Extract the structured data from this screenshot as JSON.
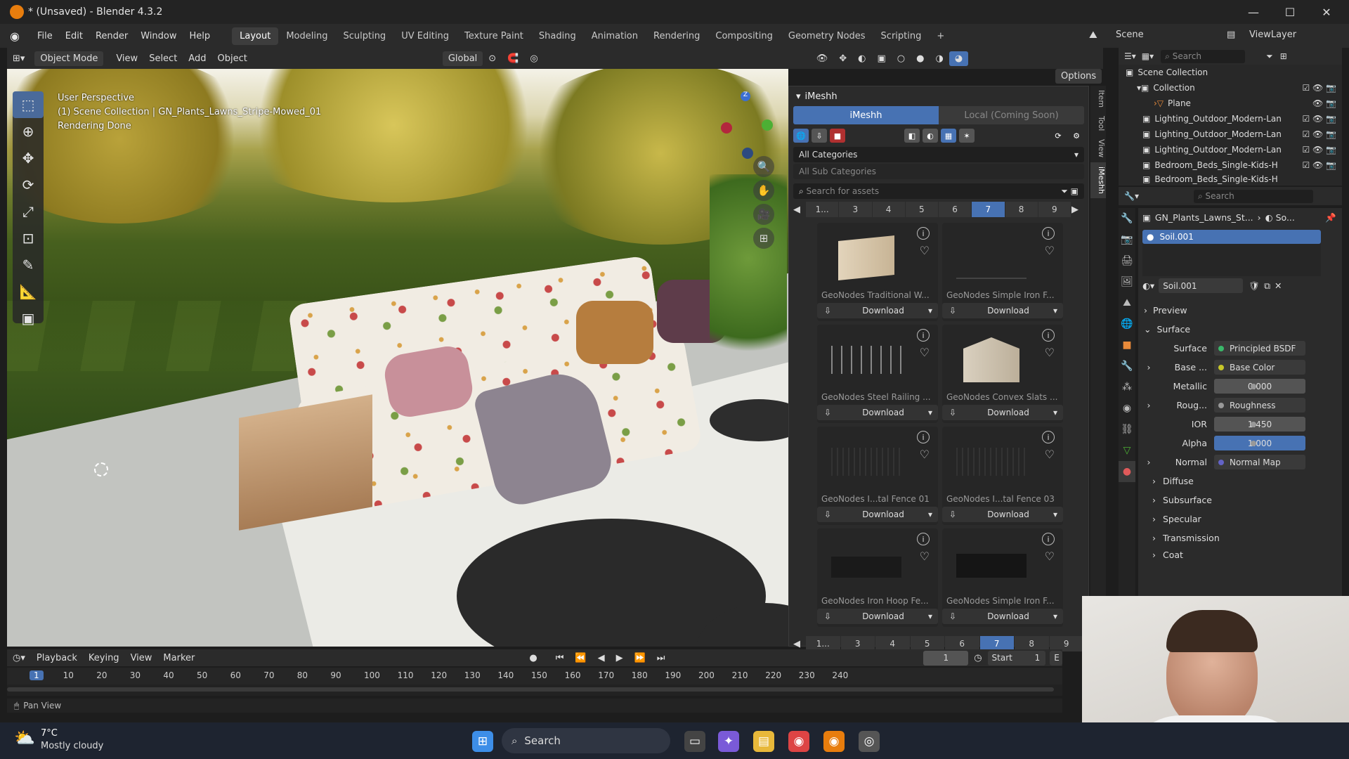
{
  "window": {
    "title": "* (Unsaved) - Blender 4.3.2"
  },
  "menu": [
    "File",
    "Edit",
    "Render",
    "Window",
    "Help"
  ],
  "workspaces": [
    "Layout",
    "Modeling",
    "Sculpting",
    "UV Editing",
    "Texture Paint",
    "Shading",
    "Animation",
    "Rendering",
    "Compositing",
    "Geometry Nodes",
    "Scripting",
    "+"
  ],
  "active_workspace": "Layout",
  "topright": {
    "scene": "Scene",
    "viewlayer": "ViewLayer"
  },
  "viewport_header": {
    "mode": "Object Mode",
    "view": "View",
    "select": "Select",
    "add": "Add",
    "object": "Object",
    "orientation": "Global",
    "options": "Options"
  },
  "overlay": {
    "line1": "User Perspective",
    "line2": "(1) Scene Collection | GN_Plants_Lawns_Stripe-Mowed_01",
    "line3": "Rendering Done"
  },
  "imeshh": {
    "title": "iMeshh",
    "tab_active": "iMeshh",
    "tab_other": "Local (Coming Soon)",
    "category": "All Categories",
    "subcategory": "All Sub Categories",
    "search_placeholder": "Search for assets",
    "pages": [
      "1...",
      "3",
      "4",
      "5",
      "6",
      "7",
      "8",
      "9"
    ],
    "selected_page": "7",
    "download_label": "Download",
    "assets": [
      "GeoNodes Traditional W...",
      "GeoNodes Simple Iron F...",
      "GeoNodes Steel Railing ...",
      "GeoNodes Convex Slats ...",
      "GeoNodes I...tal Fence 01",
      "GeoNodes I...tal Fence 03",
      "GeoNodes Iron Hoop Fe...",
      "GeoNodes Simple Iron F..."
    ]
  },
  "side_tabs": [
    "Item",
    "Tool",
    "View",
    "iMeshh"
  ],
  "outliner": {
    "search_placeholder": "Search",
    "rows": [
      "Scene Collection",
      "Collection",
      "Plane",
      "Lighting_Outdoor_Modern-Lan",
      "Lighting_Outdoor_Modern-Lan",
      "Lighting_Outdoor_Modern-Lan",
      "Bedroom_Beds_Single-Kids-H",
      "Bedroom_Beds_Single-Kids-H"
    ]
  },
  "properties": {
    "search_placeholder": "Search",
    "breadcrumb_obj": "GN_Plants_Lawns_St...",
    "breadcrumb_mat": "So...",
    "material_slot": "Soil.001",
    "material_name": "Soil.001",
    "sections": {
      "preview": "Preview",
      "surface": "Surface"
    },
    "surface_label": "Surface",
    "surface_value": "Principled BSDF",
    "fields": [
      {
        "label": "Base ...",
        "value": "Base Color",
        "type": "link",
        "color": "#c7c729"
      },
      {
        "label": "Metallic",
        "value": "0.000",
        "type": "num",
        "color": "#999999"
      },
      {
        "label": "Roug...",
        "value": "Roughness",
        "type": "link",
        "color": "#999999"
      },
      {
        "label": "IOR",
        "value": "1.450",
        "type": "num",
        "color": "#999999"
      },
      {
        "label": "Alpha",
        "value": "1.000",
        "type": "numblue",
        "color": "#999999"
      },
      {
        "label": "Normal",
        "value": "Normal Map",
        "type": "link",
        "color": "#6363c7"
      }
    ],
    "subsections": [
      "Diffuse",
      "Subsurface",
      "Specular",
      "Transmission",
      "Coat"
    ]
  },
  "timeline": {
    "menus": [
      "Playback",
      "Keying",
      "View",
      "Marker"
    ],
    "current_frame": "1",
    "start_label": "Start",
    "start_value": "1",
    "end_label": "E",
    "ruler": [
      "1",
      "10",
      "20",
      "30",
      "40",
      "50",
      "60",
      "70",
      "80",
      "90",
      "100",
      "110",
      "120",
      "130",
      "140",
      "150",
      "160",
      "170",
      "180",
      "190",
      "200",
      "210",
      "220",
      "230",
      "240"
    ]
  },
  "statusbar": {
    "hint": "Pan View"
  },
  "taskbar": {
    "temp": "7°C",
    "weather": "Mostly cloudy",
    "search": "Search"
  }
}
